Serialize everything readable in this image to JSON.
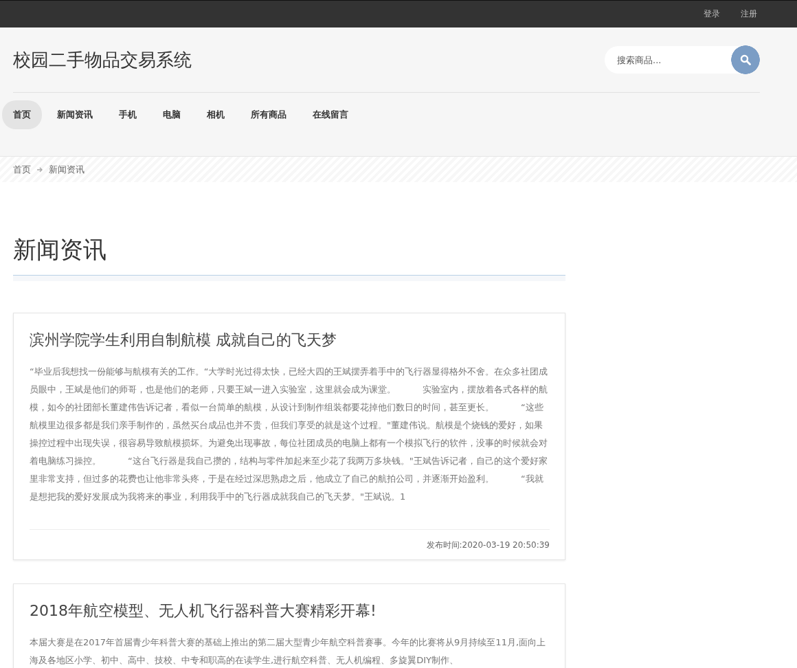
{
  "top_bar": {
    "links": [
      "登录",
      "注册"
    ]
  },
  "site_title": "校园二手物品交易系统",
  "search": {
    "placeholder": "搜索商品..."
  },
  "nav": [
    {
      "label": "首页",
      "selected": true
    },
    {
      "label": "新闻资讯",
      "selected": false
    },
    {
      "label": "手机",
      "selected": false
    },
    {
      "label": "电脑",
      "selected": false
    },
    {
      "label": "相机",
      "selected": false
    },
    {
      "label": "所有商品",
      "selected": false
    },
    {
      "label": "在线留言",
      "selected": false
    }
  ],
  "breadcrumb": [
    "首页",
    "新闻资讯"
  ],
  "page_heading": "新闻资讯",
  "articles": [
    {
      "title": "滨州学院学生利用自制航模 成就自己的飞天梦",
      "body": "“毕业后我想找一份能够与航模有关的工作。“大学时光过得太快，已经大四的王斌摆弄着手中的飞行器显得格外不舍。在众多社团成员眼中，王斌是他们的师哥，也是他们的老师，只要王斌一进入实验室，这里就会成为课堂。　　　实验室内，摆放着各式各样的航模，如今的社团部长董建伟告诉记者，看似一台简单的航模，从设计到制作组装都要花掉他们数日的时间，甚至更长。　　　“这些航模里边很多都是我们亲手制作的，虽然买台成品也并不贵，但我们享受的就是这个过程。\"董建伟说。航模是个烧钱的爱好，如果操控过程中出现失误，很容易导致航模损坏。为避免出现事故，每位社团成员的电脑上都有一个模拟飞行的软件，没事的时候就会对着电脑练习操控。　　　“这台飞行器是我自己攒的，结构与零件加起来至少花了我两万多块钱。\"王斌告诉记者，自己的这个爱好家里非常支持，但过多的花费也让他非常头疼，于是在经过深思熟虑之后，他成立了自己的航拍公司，并逐渐开始盈利。　　　“我就是想把我的爱好发展成为我将来的事业，利用我手中的飞行器成就我自己的飞天梦。\"王斌说。1",
      "published": "发布时间:2020-03-19 20:50:39"
    },
    {
      "title": "2018年航空模型、无人机飞行器科普大赛精彩开幕!",
      "body": "本届大赛是在2017年首届青少年科普大赛的基础上推出的第二届大型青少年航空科普赛事。今年的比赛将从9月持续至11月,面向上海及各地区小学、初中、高中、技校、中专和职高的在读学生,进行航空科普、无人机编程、多旋翼DIY制作、"
    }
  ]
}
